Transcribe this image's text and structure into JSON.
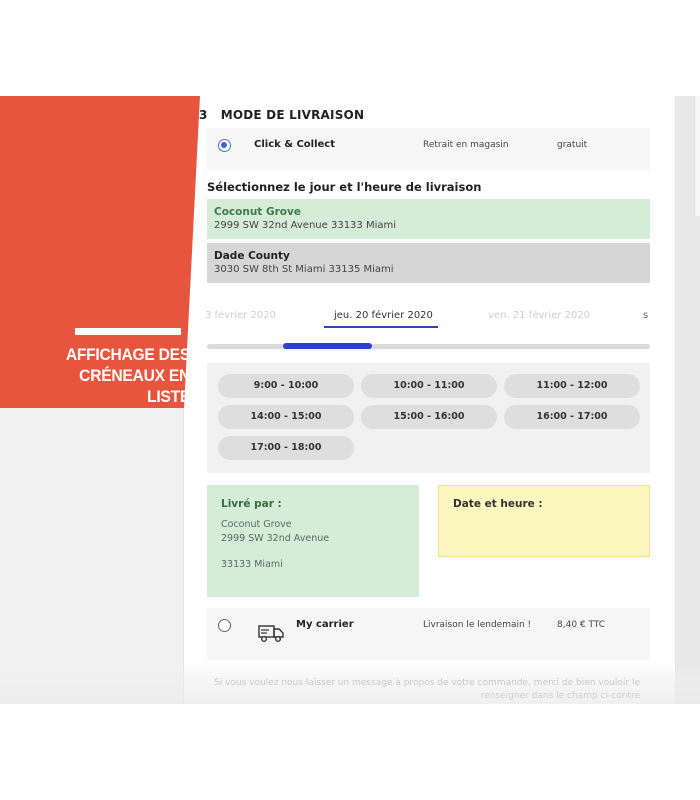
{
  "promo": {
    "line1": "AFFICHAGE DES",
    "line2": "CRÉNEAUX EN LISTE"
  },
  "step": {
    "number": "3",
    "title": "MODE DE LIVRAISON"
  },
  "click_collect": {
    "name": "Click & Collect",
    "description": "Retrait en magasin",
    "price": "gratuit",
    "selected": true
  },
  "select_title": "Sélectionnez le jour et l'heure de livraison",
  "stores": [
    {
      "name": "Coconut Grove",
      "address": "2999 SW 32nd Avenue 33133 Miami"
    },
    {
      "name": "Dade County",
      "address": "3030 SW 8th St Miami 33135 Miami"
    }
  ],
  "dates": [
    "3 février 2020",
    "jeu. 20 février 2020",
    "ven. 21 février 2020",
    "s"
  ],
  "slots": [
    "9:00 - 10:00",
    "10:00 - 11:00",
    "11:00 - 12:00",
    "14:00 - 15:00",
    "15:00 - 16:00",
    "16:00 - 17:00",
    "17:00 - 18:00"
  ],
  "delivered_by": {
    "title": "Livré par :",
    "line1": "Coconut Grove",
    "line2": "2999 SW 32nd Avenue",
    "line3": "33133 Miami"
  },
  "date_time": {
    "title": "Date et heure :"
  },
  "my_carrier": {
    "name": "My carrier",
    "description": "Livraison le lendemain !",
    "price": "8,40 € TTC",
    "selected": false
  },
  "message": {
    "line1": "Si vous voulez nous laisser un message à propos de votre commande, merci de bien vouloir le",
    "line2": "renseigner dans le champ ci-contre"
  },
  "colors": {
    "accent": "#2d3fd0",
    "promo": "#e8553f",
    "store_selected": "#d5ecd7",
    "date_box": "#fcf6bf"
  },
  "icons": {
    "truck": "delivery-truck-icon"
  }
}
